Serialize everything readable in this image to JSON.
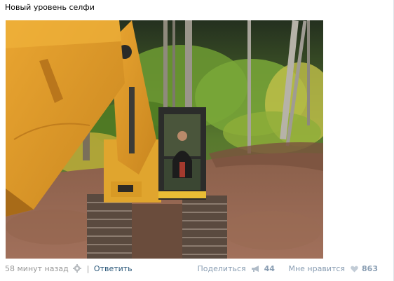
{
  "post": {
    "text": "Новый уровень селфи",
    "image_alt": "excavator-selfie-photo",
    "time": "58 минут назад",
    "reply_label": "Ответить",
    "share_label": "Поделиться",
    "share_count": "44",
    "like_label": "Мне нравится",
    "like_count": "863"
  },
  "icons": {
    "settings": "gear-icon",
    "share": "megaphone-icon",
    "like": "heart-icon"
  },
  "colors": {
    "link": "#2b587a",
    "muted": "#999999",
    "action": "#8a9eb3"
  }
}
